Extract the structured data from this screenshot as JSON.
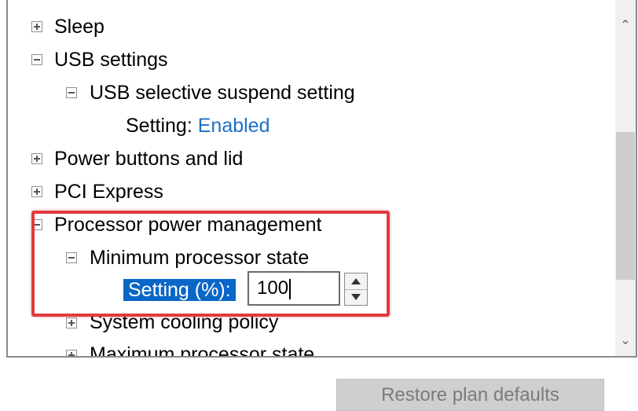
{
  "tree": {
    "sleep": "Sleep",
    "usb_settings": "USB settings",
    "usb_selective_suspend": "USB selective suspend setting",
    "usb_setting_label": "Setting:",
    "usb_setting_value": "Enabled",
    "power_buttons": "Power buttons and lid",
    "pci_express": "PCI Express",
    "processor_power": "Processor power management",
    "min_processor_state": "Minimum processor state",
    "min_setting_label": "Setting (%):",
    "min_setting_value": "100",
    "system_cooling": "System cooling policy",
    "max_processor_state": "Maximum processor state"
  },
  "buttons": {
    "restore_defaults": "Restore plan defaults"
  },
  "icons": {
    "expand": "plus-expander-icon",
    "collapse": "minus-collapser-icon",
    "spin_up": "spin-up-arrow-icon",
    "spin_down": "spin-down-arrow-icon",
    "scroll_up": "chevron-up-icon",
    "scroll_down": "chevron-down-icon"
  },
  "colors": {
    "link": "#1a6fc9",
    "selection": "#0a66c7",
    "highlight_box": "#e03a3e"
  }
}
